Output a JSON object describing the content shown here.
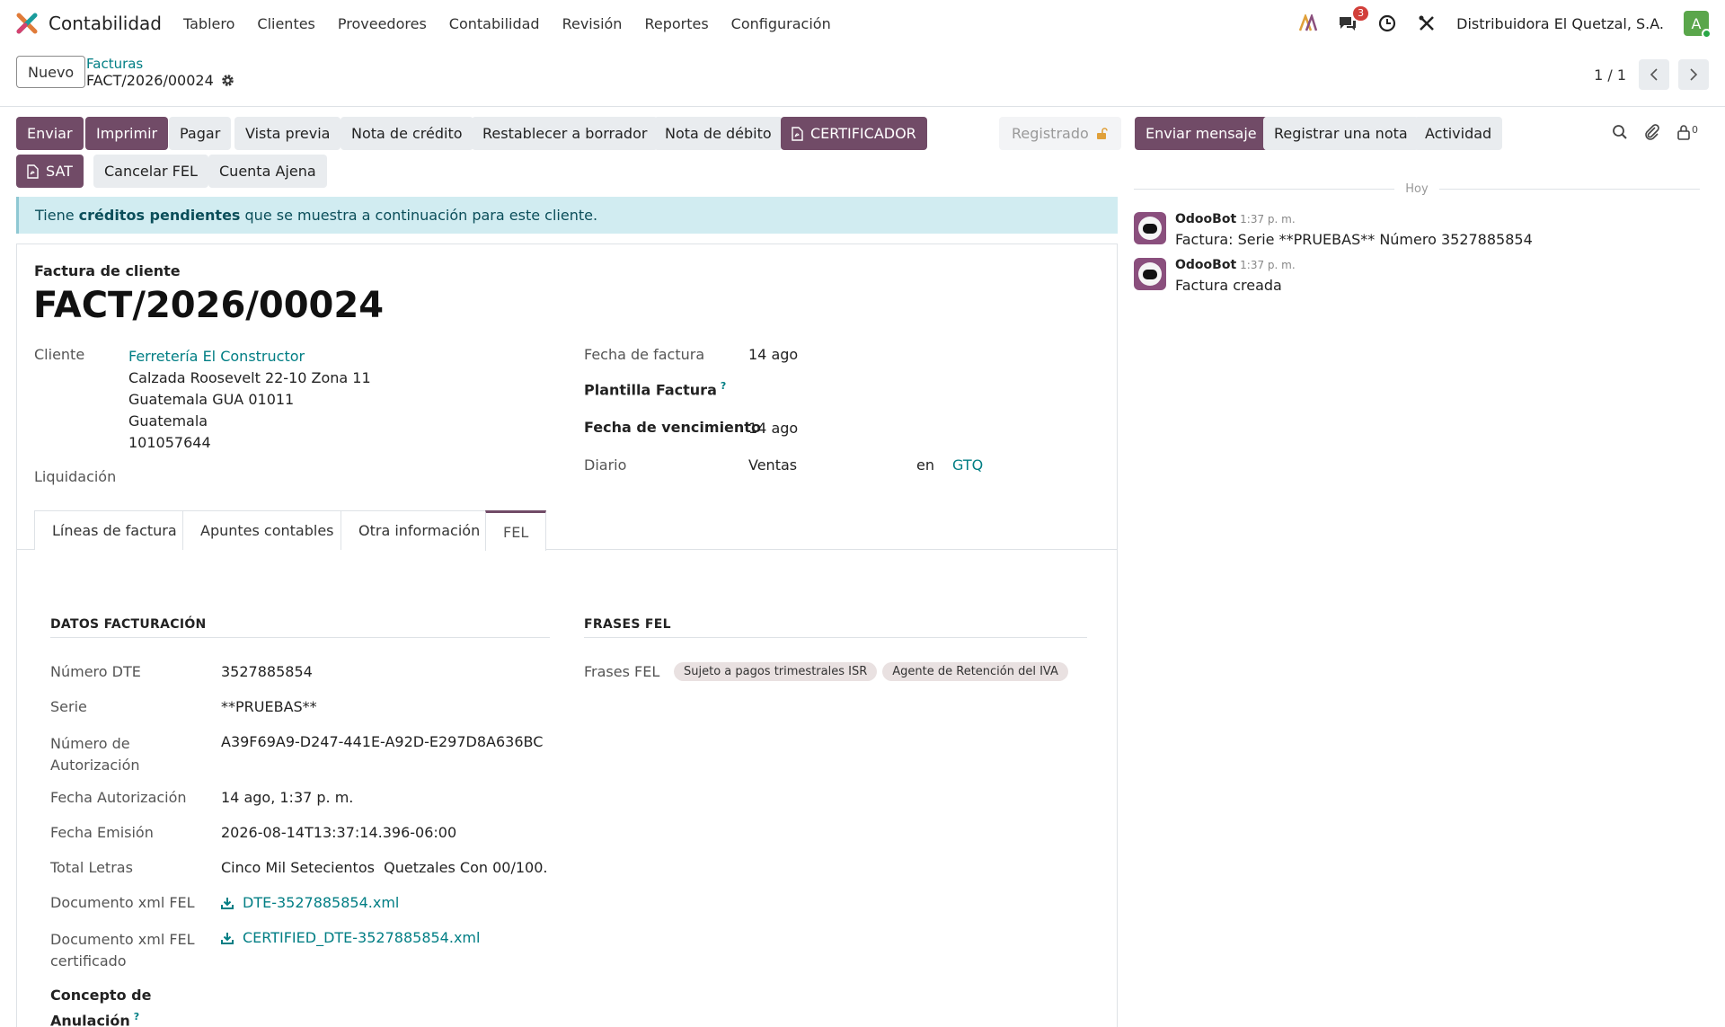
{
  "navbar": {
    "app_name": "Contabilidad",
    "menu": [
      "Tablero",
      "Clientes",
      "Proveedores",
      "Contabilidad",
      "Revisión",
      "Reportes",
      "Configuración"
    ],
    "messages_count": "3",
    "company": "Distribuidora El Quetzal, S.A.",
    "avatar_letter": "A"
  },
  "control": {
    "new_label": "Nuevo",
    "breadcrumb_parent": "Facturas",
    "breadcrumb_current": "FACT/2026/00024",
    "pager": "1 / 1"
  },
  "actions": {
    "enviar": "Enviar",
    "imprimir": "Imprimir",
    "pagar": "Pagar",
    "vista_previa": "Vista previa",
    "nota_credito": "Nota de crédito",
    "restablecer": "Restablecer a borrador",
    "nota_debito": "Nota de débito",
    "certificador": "CERTIFICADOR",
    "sat": "SAT",
    "cancelar_fel": "Cancelar FEL",
    "cuenta_ajena": "Cuenta Ajena",
    "status": "Registrado"
  },
  "alert": {
    "before": "Tiene ",
    "bold": "créditos pendientes",
    "after": " que se muestra a continuación para este cliente."
  },
  "invoice": {
    "type": "Factura de cliente",
    "name": "FACT/2026/00024",
    "cliente_label": "Cliente",
    "cliente_name": "Ferretería El Constructor",
    "address": [
      "Calzada Roosevelt 22-10 Zona 11",
      "Guatemala GUA 01011",
      "Guatemala",
      "101057644"
    ],
    "liquidacion_label": "Liquidación",
    "fecha_factura_label": "Fecha de factura",
    "fecha_factura": "14 ago",
    "plantilla_label": "Plantilla Factura",
    "help_mark": "?",
    "vencimiento_label": "Fecha de vencimiento",
    "vencimiento": "14 ago",
    "diario_label": "Diario",
    "diario": "Ventas",
    "en": "en",
    "currency": "GTQ"
  },
  "tabs": [
    "Líneas de factura",
    "Apuntes contables",
    "Otra información",
    "FEL"
  ],
  "fel": {
    "datos_title": "DATOS FACTURACIÓN",
    "frases_title": "FRASES FEL",
    "frases_label": "Frases FEL",
    "frases": [
      "Sujeto a pagos trimestrales ISR",
      "Agente de Retención del IVA"
    ],
    "numero_dte_label": "Número DTE",
    "numero_dte": "3527885854",
    "serie_label": "Serie",
    "serie": "**PRUEBAS**",
    "autorizacion_label_1": "Número de",
    "autorizacion_label_2": "Autorización",
    "autorizacion": "A39F69A9-D247-441E-A92D-E297D8A636BC",
    "fecha_aut_label": "Fecha Autorización",
    "fecha_aut": "14 ago, 1:37 p. m.",
    "fecha_emision_label": "Fecha Emisión",
    "fecha_emision": "2026-08-14T13:37:14.396-06:00",
    "total_letras_label": "Total Letras",
    "total_letras": "Cinco Mil Setecientos  Quetzales Con 00/100.",
    "xml_label": "Documento xml FEL",
    "xml_file": "DTE-3527885854.xml",
    "xml_cert_label_1": "Documento xml FEL",
    "xml_cert_label_2": "certificado",
    "xml_cert_file": "CERTIFIED_DTE-3527885854.xml",
    "concepto_label_1": "Concepto de",
    "concepto_label_2": "Anulación"
  },
  "chatter": {
    "enviar_mensaje": "Enviar mensaje",
    "registrar_nota": "Registrar una nota",
    "actividad": "Actividad",
    "followers": "0",
    "day": "Hoy",
    "messages": [
      {
        "author": "OdooBot",
        "time": "1:37 p. m.",
        "body": "Factura: Serie **PRUEBAS** Número 3527885854"
      },
      {
        "author": "OdooBot",
        "time": "1:37 p. m.",
        "body": "Factura creada"
      }
    ]
  },
  "colors": {
    "primary": "#714b67",
    "link": "#017e84",
    "alert_bg": "#d1ecf1"
  }
}
